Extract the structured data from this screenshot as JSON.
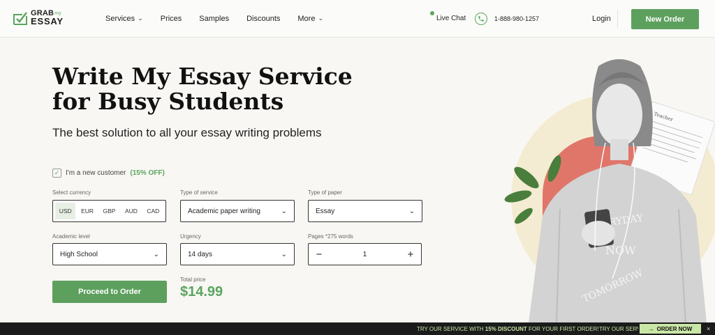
{
  "brand": {
    "line1": "GRAB",
    "sub": "my",
    "line2": "ESSAY"
  },
  "nav": {
    "services": "Services",
    "prices": "Prices",
    "samples": "Samples",
    "discounts": "Discounts",
    "more": "More"
  },
  "header": {
    "live_chat": "Live Chat",
    "phone": "1-888-980-1257",
    "login": "Login",
    "new_order": "New Order"
  },
  "hero": {
    "title": "Write My Essay Service for Busy Students",
    "subtitle": "The best solution to all your essay writing problems"
  },
  "form": {
    "new_customer_label": "I'm a new customer",
    "new_customer_discount": "(15% OFF)",
    "new_customer_checked": true,
    "currency_label": "Select currency",
    "currencies": [
      "USD",
      "EUR",
      "GBP",
      "AUD",
      "CAD"
    ],
    "currency_selected": "USD",
    "service_label": "Type of service",
    "service_value": "Academic paper writing",
    "paper_label": "Type of paper",
    "paper_value": "Essay",
    "level_label": "Academic level",
    "level_value": "High School",
    "urgency_label": "Urgency",
    "urgency_value": "14 days",
    "pages_label": "Pages *275 words",
    "pages_value": "1",
    "minus": "−",
    "plus": "+",
    "proceed": "Proceed to Order",
    "total_label": "Total price",
    "total_value": "$14.99"
  },
  "shirt_text": {
    "line1": "EVERYDAY",
    "line2": "NOW",
    "line3": "TOMORROW"
  },
  "paper_text": "Teacher",
  "banner": {
    "pre": "TRY OUR SERVICE WITH ",
    "discount": "15% DISCOUNT",
    "post": " FOR YOUR FIRST ORDER!",
    "repeat": "TRY OUR SERVICE WITH",
    "cta": "ORDER NOW",
    "close": "×"
  },
  "colors": {
    "accent": "#5da05e",
    "banner_bg": "#1b1b1b",
    "banner_text": "#c8e6a8"
  }
}
